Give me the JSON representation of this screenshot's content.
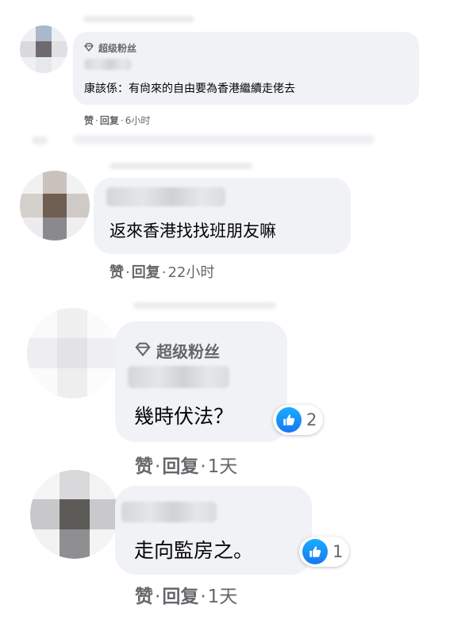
{
  "comments": [
    {
      "badge": "超级粉丝",
      "text": "康該係：有尙來的自由要為香港繼續走佬去",
      "like_label": "赞",
      "reply_label": "回复",
      "time": "6小时"
    },
    {
      "text": "返來香港找找班朋友嘛",
      "like_label": "赞",
      "reply_label": "回复",
      "time": "22小时"
    },
    {
      "badge": "超级粉丝",
      "text": "幾時伏法？",
      "reaction_count": "2",
      "like_label": "赞",
      "reply_label": "回复",
      "time": "1天"
    },
    {
      "text": "走向監房之。",
      "reaction_count": "1",
      "like_label": "赞",
      "reply_label": "回复",
      "time": "1天"
    }
  ],
  "colors": {
    "bubble": "#f0f2f5",
    "meta_text": "#65676b",
    "like_blue": "#1877f2"
  },
  "icons": {
    "badge": "diamond-icon",
    "reaction": "thumbs-up-icon"
  }
}
